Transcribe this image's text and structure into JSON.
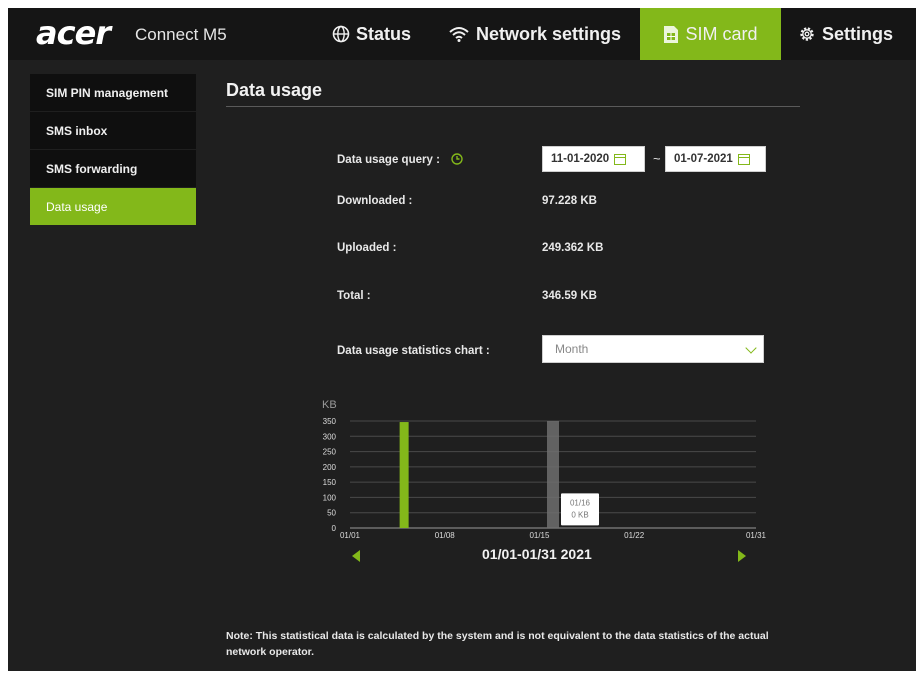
{
  "header": {
    "logo": "acer",
    "product": "Connect M5",
    "nav": [
      {
        "label": "Status",
        "icon": "globe-icon"
      },
      {
        "label": "Network settings",
        "icon": "wifi-icon"
      },
      {
        "label": "SIM card",
        "icon": "sim-card-icon",
        "active": true
      },
      {
        "label": "Settings",
        "icon": "gear-icon"
      }
    ]
  },
  "sidebar": {
    "items": [
      {
        "label": "SIM PIN management"
      },
      {
        "label": "SMS inbox"
      },
      {
        "label": "SMS forwarding"
      },
      {
        "label": "Data usage",
        "active": true
      }
    ]
  },
  "main": {
    "title": "Data usage",
    "query_label": "Data usage query :",
    "date_from": "11-01-2020",
    "date_separator": "~",
    "date_to": "01-07-2021",
    "downloaded_label": "Downloaded :",
    "downloaded_value": "97.228 KB",
    "uploaded_label": "Uploaded :",
    "uploaded_value": "249.362 KB",
    "total_label": "Total :",
    "total_value": "346.59 KB",
    "chart_label": "Data usage statistics chart :",
    "chart_select_value": "Month",
    "period": "01/01-01/31 2021",
    "note": "Note: This statistical data is calculated by the system and is not equivalent to the data statistics of the actual network operator."
  },
  "colors": {
    "accent": "#83b81a",
    "hover_bar": "#6f6f6f",
    "background": "#1f1f1f",
    "topbar": "#151515"
  },
  "chart_data": {
    "type": "bar",
    "ylabel": "KB",
    "yticks": [
      0,
      50,
      100,
      150,
      200,
      250,
      300,
      350
    ],
    "ylim": [
      0,
      350
    ],
    "xlim": [
      1,
      31
    ],
    "xtick_labels": [
      "01/01",
      "01/08",
      "01/15",
      "01/22",
      "01/31"
    ],
    "series": [
      {
        "values": [
          {
            "x": 5,
            "y": 346.59
          },
          {
            "x": 16,
            "y": 0
          }
        ]
      }
    ],
    "hover_bar": {
      "x": 16,
      "y": 350
    },
    "tooltip": {
      "date": "01/16",
      "value": "0 KB"
    }
  }
}
